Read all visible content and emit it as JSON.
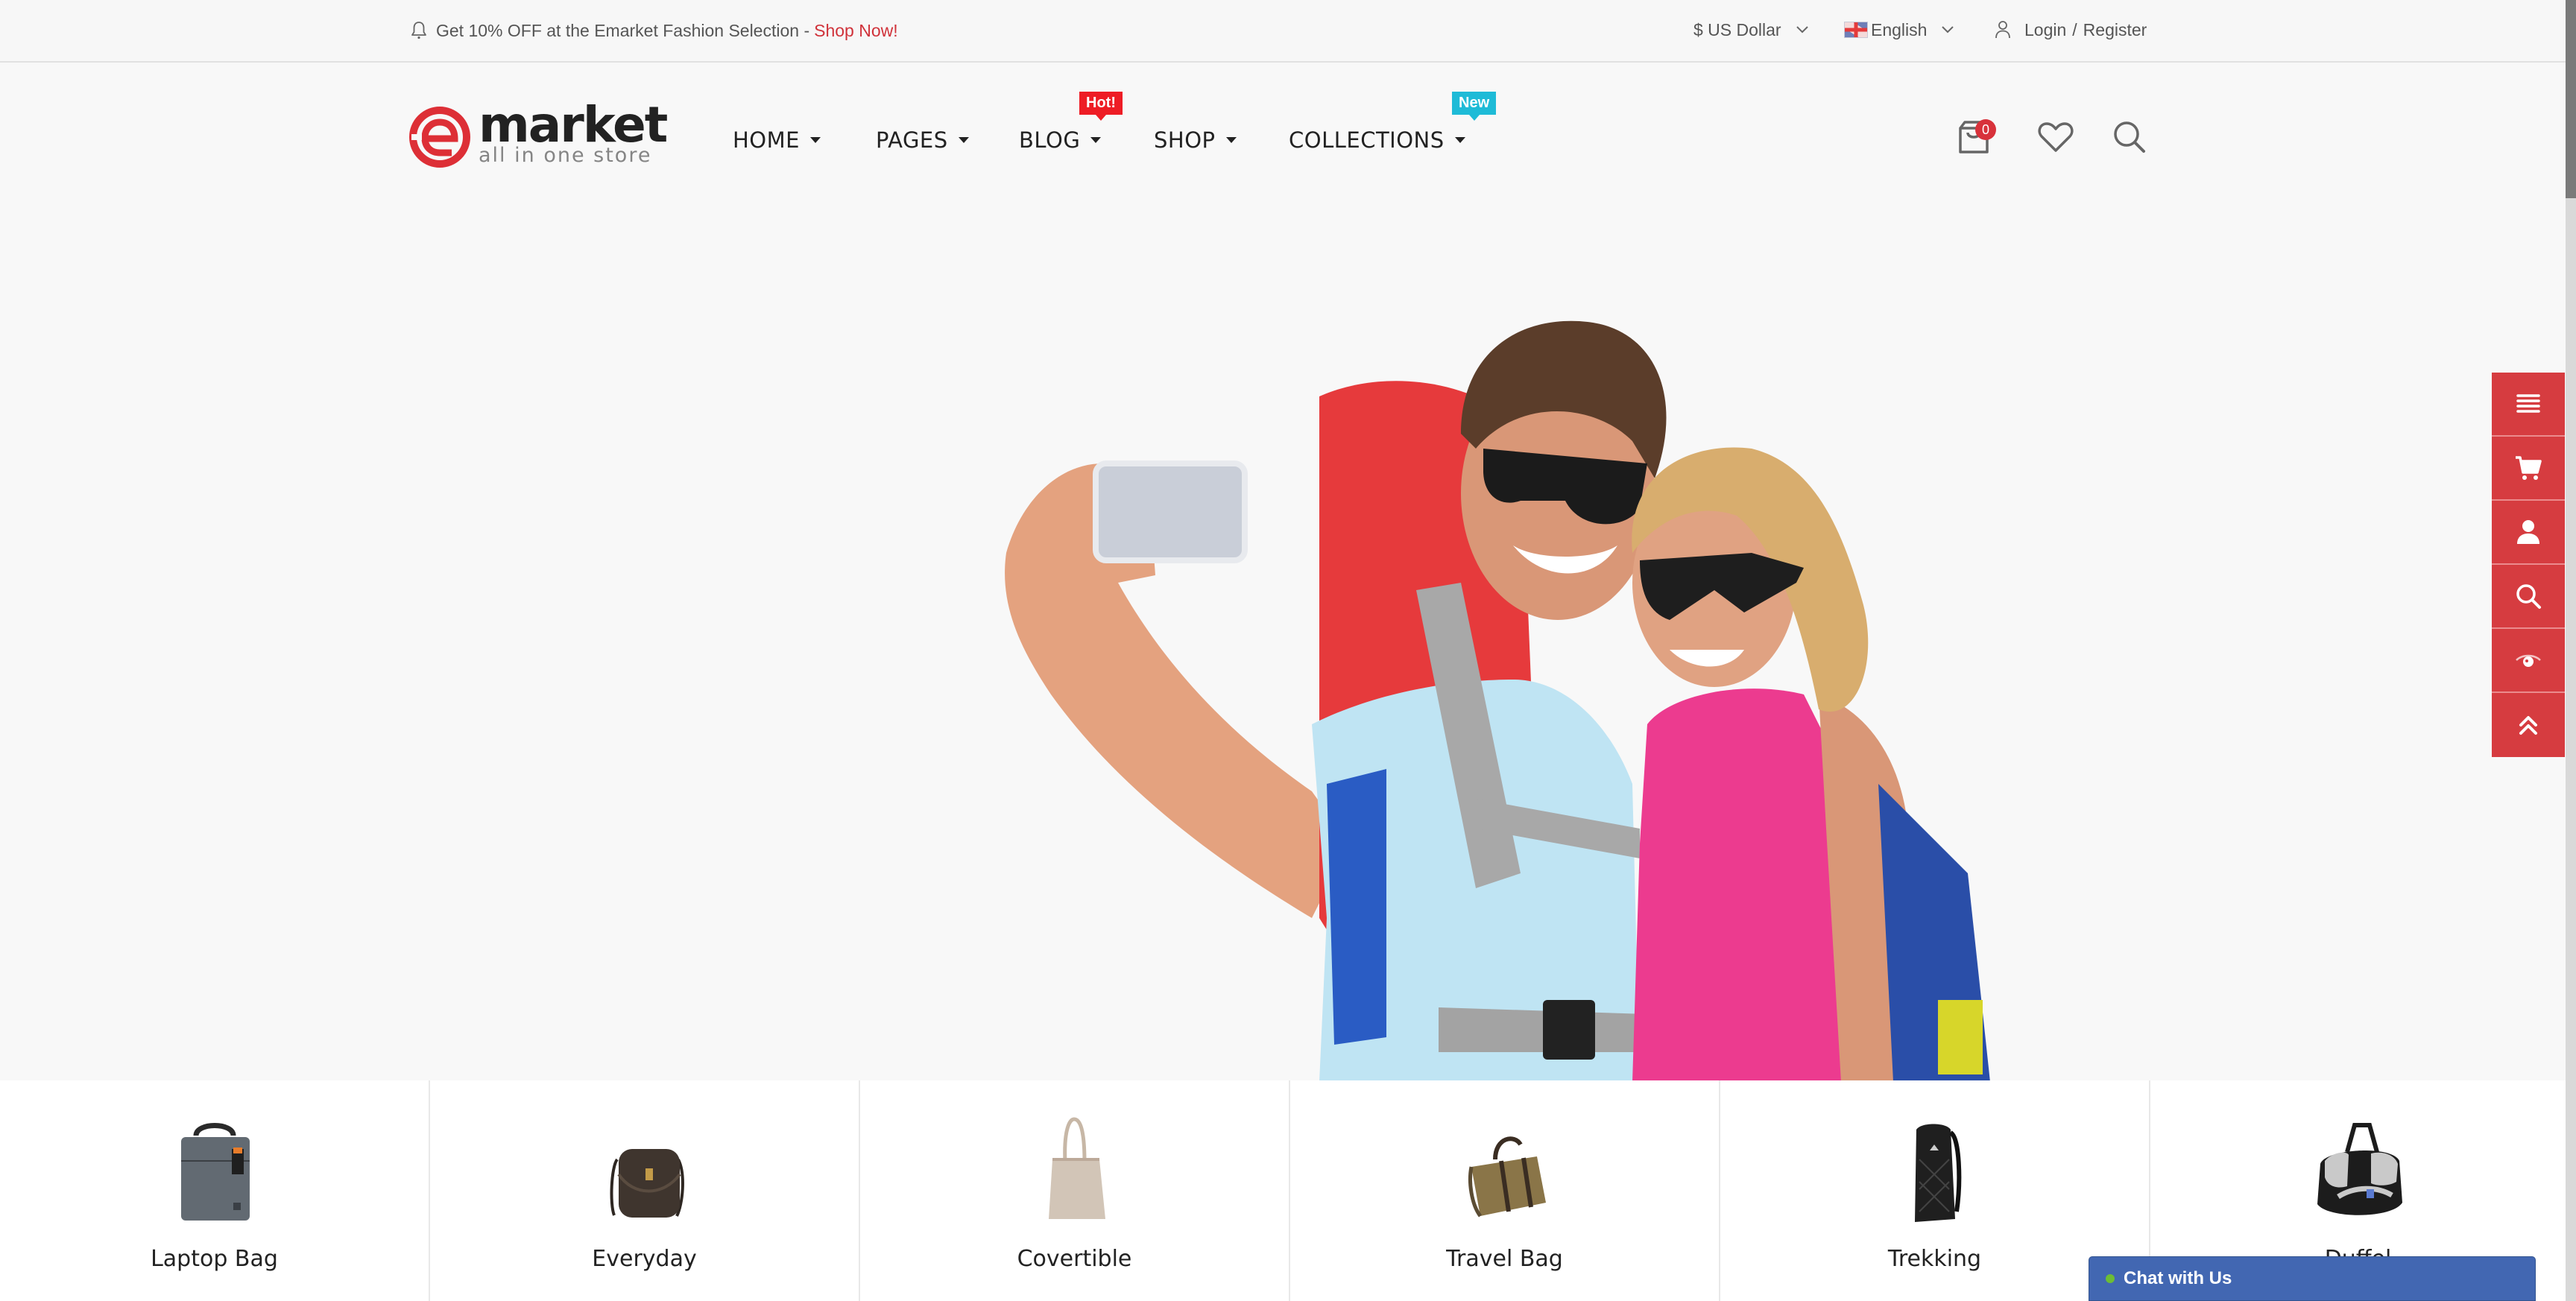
{
  "topbar": {
    "promo_text": "Get 10% OFF at the Emarket Fashion Selection -",
    "promo_link": "Shop Now!",
    "currency": "$ US Dollar",
    "language": "English",
    "login": "Login",
    "separator": "/",
    "register": "Register"
  },
  "logo": {
    "wordmark": "market",
    "tagline": "all in one store"
  },
  "nav": {
    "items": [
      {
        "label": "HOME"
      },
      {
        "label": "PAGES"
      },
      {
        "label": "BLOG",
        "badge": "Hot!"
      },
      {
        "label": "SHOP"
      },
      {
        "label": "COLLECTIONS",
        "badge": "New"
      }
    ]
  },
  "header_icons": {
    "cart_count": "0"
  },
  "categories": [
    {
      "label": "Laptop Bag"
    },
    {
      "label": "Everyday"
    },
    {
      "label": "Covertible"
    },
    {
      "label": "Travel Bag"
    },
    {
      "label": "Trekking"
    },
    {
      "label": "Duffel"
    }
  ],
  "side_tools": [
    "menu-icon",
    "cart-icon",
    "user-icon",
    "search-icon",
    "eye-icon",
    "scroll-top-icon"
  ],
  "chat": {
    "label": "Chat with Us",
    "status_color": "#6cbd35"
  },
  "colors": {
    "accent": "#d63c40",
    "hot_badge": "#ee1c25",
    "new_badge": "#1ebbd7",
    "chat_bg": "#4267b2"
  }
}
